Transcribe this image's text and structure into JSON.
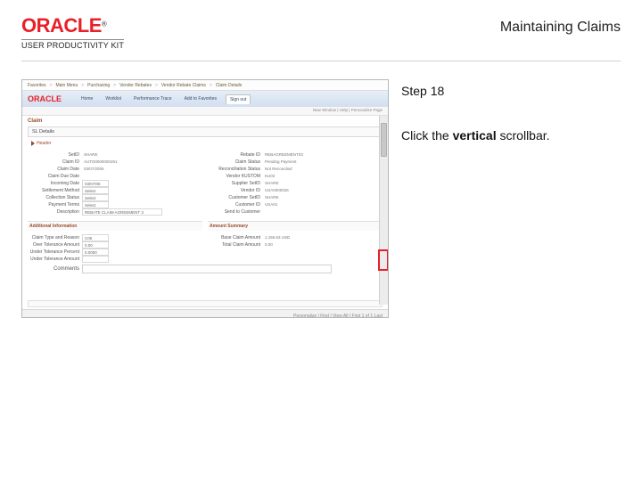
{
  "header": {
    "brand_main": "ORACLE",
    "brand_tm": "®",
    "brand_sub": "USER PRODUCTIVITY KIT",
    "doc_title": "Maintaining Claims"
  },
  "sidebar": {
    "step_label": "Step 18",
    "instruction_pre": "Click the ",
    "instruction_bold": "vertical",
    "instruction_post": " scrollbar."
  },
  "app": {
    "breadcrumb": [
      "Favorites",
      "Main Menu",
      "Purchasing",
      "Vendor Rebates",
      "Vendor Rebate Claims",
      "Claim Details"
    ],
    "logo": "ORACLE",
    "tabs": [
      "Home",
      "Worklist",
      "Performance Trace",
      "Add to Favorites",
      "Sign out"
    ],
    "subbar": "New Window | Help | Personalize Page",
    "section_claim": "Claim",
    "sel_left": "SL Details",
    "sel_right": "",
    "header_toggle": "Header",
    "form": {
      "left": [
        {
          "label": "SetID",
          "value": "SHARE",
          "ro": true
        },
        {
          "label": "Claim ID",
          "value": "AUTO0000000251",
          "ro": true
        },
        {
          "label": "Claim Date",
          "value": "03/07/2006",
          "ro": true
        },
        {
          "label": "Claim Due Date",
          "value": "",
          "ro": true
        },
        {
          "label": "Incoming Date",
          "value": "03/07/06"
        },
        {
          "label": "Settlement Method",
          "value": "Select"
        },
        {
          "label": "Collection Status",
          "value": "Select"
        },
        {
          "label": "Payment Terms",
          "value": "Select"
        },
        {
          "label": "Description",
          "value": "REBATE CLAIM AGREEMENT 3"
        }
      ],
      "right": [
        {
          "label": "Rebate ID",
          "value": "REBAGREEMENT03",
          "ro": true
        },
        {
          "label": "Claim Status",
          "value": "Pending Payment",
          "ro": true
        },
        {
          "label": "Reconciliation Status",
          "value": "Not Reconciled",
          "ro": true
        },
        {
          "label": "Vendor KUSTOM",
          "value": "KU02",
          "ro": true
        },
        {
          "label": "Supplier SetID",
          "value": "SHARE",
          "ro": true
        },
        {
          "label": "Vendor ID",
          "value": "USA0000026",
          "ro": true
        },
        {
          "label": "Customer SetID",
          "value": "SHARE",
          "ro": true
        },
        {
          "label": "Customer ID",
          "value": "USA01",
          "ro": true
        },
        {
          "label": "Send to Customer",
          "value": "",
          "ro": true
        }
      ]
    },
    "sections": {
      "left": "Additional Information",
      "right": "Amount Summary"
    },
    "lower": {
      "left": [
        {
          "label": "Claim Type and Reason",
          "value": "C06"
        },
        {
          "label": "Over Tolerance Amount",
          "value": "0.00"
        },
        {
          "label": "Under Tolerance Percent",
          "value": "0.0000"
        },
        {
          "label": "Under Tolerance Amount",
          "value": ""
        }
      ],
      "right": [
        {
          "label": "Base Claim Amount",
          "value": "1,156.63   USD"
        },
        {
          "label": "Total Claim Amount",
          "value": "0.00"
        }
      ]
    },
    "comments_label": "Comments",
    "status_bar": "",
    "footer_left": "",
    "footer_right": "Personalize | Find | View All | First 1 of 1 Last"
  }
}
